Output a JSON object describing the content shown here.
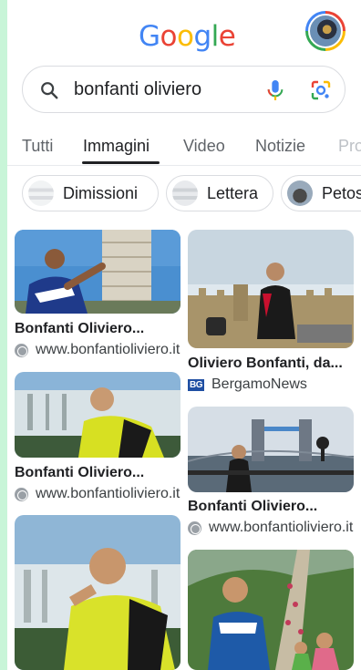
{
  "logo": {
    "letters": [
      "G",
      "o",
      "o",
      "g",
      "l",
      "e"
    ],
    "colors": [
      "#4285f4",
      "#ea4335",
      "#fbbc04",
      "#4285f4",
      "#34a853",
      "#ea4335"
    ]
  },
  "search": {
    "query": "bonfanti oliviero",
    "icons": [
      "search-icon",
      "mic-icon",
      "lens-icon"
    ]
  },
  "tabs": [
    {
      "label": "Tutti"
    },
    {
      "label": "Immagini",
      "active": true
    },
    {
      "label": "Video"
    },
    {
      "label": "Notizie"
    },
    {
      "label": "Pro"
    }
  ],
  "chips": [
    {
      "label": "Dimissioni"
    },
    {
      "label": "Lettera"
    },
    {
      "label": "Petosino"
    }
  ],
  "results": [
    {
      "title": "Bonfanti Oliviero...",
      "source": "www.bonfantioliviero.it",
      "source_icon": "globe-icon"
    },
    {
      "title": "Oliviero Bonfanti, da...",
      "source": "BergamoNews",
      "source_icon": "BG",
      "source_badge": "BG"
    },
    {
      "title": "Bonfanti Oliviero...",
      "source": "www.bonfantioliviero.it",
      "source_icon": "globe-icon"
    },
    {
      "title": "Bonfanti Oliviero...",
      "source": "www.bonfantioliviero.it",
      "source_icon": "globe-icon"
    }
  ],
  "colors": {
    "accent": "#1a73e8",
    "text": "#202124",
    "muted": "#5f6368",
    "border": "#dadce0"
  }
}
